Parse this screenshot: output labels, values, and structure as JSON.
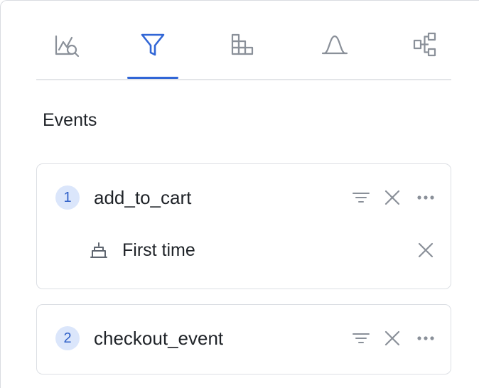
{
  "tabs": [
    {
      "name": "trends",
      "icon": "chart-search-icon",
      "active": false
    },
    {
      "name": "funnels",
      "icon": "funnel-icon",
      "active": true
    },
    {
      "name": "retention",
      "icon": "retention-grid-icon",
      "active": false
    },
    {
      "name": "distribution",
      "icon": "bell-curve-icon",
      "active": false
    },
    {
      "name": "flows",
      "icon": "flow-branch-icon",
      "active": false
    }
  ],
  "section": {
    "title": "Events"
  },
  "events": [
    {
      "index": "1",
      "name": "add_to_cart",
      "filters": [
        {
          "label": "First time",
          "icon": "cake-icon"
        }
      ]
    },
    {
      "index": "2",
      "name": "checkout_event",
      "filters": []
    }
  ],
  "colors": {
    "accent": "#3166d6",
    "badge_bg": "#dbe6fb",
    "badge_text": "#2e5fc7",
    "icon_gray": "#8a9099"
  }
}
